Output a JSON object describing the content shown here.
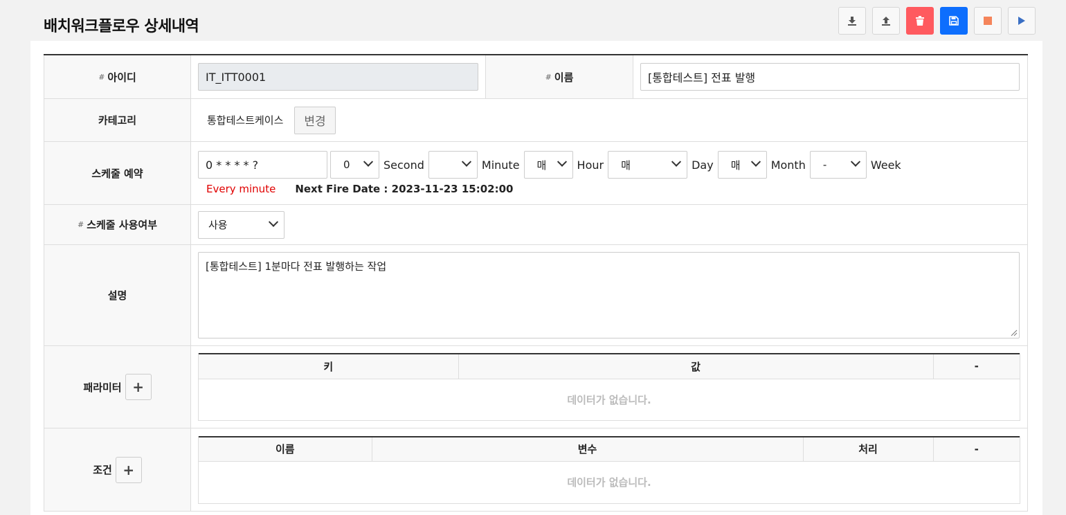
{
  "page": {
    "title": "배치워크플로우 상세내역"
  },
  "toolbar": {
    "buttons": [
      {
        "icon": "download-icon"
      },
      {
        "icon": "upload-icon"
      },
      {
        "icon": "trash-icon",
        "color": "#ff5a5f"
      },
      {
        "icon": "save-icon",
        "color": "#0d6efd"
      },
      {
        "icon": "stop-icon",
        "icon_color": "#f5855b"
      },
      {
        "icon": "play-icon",
        "icon_color": "#3a6fc4"
      }
    ]
  },
  "form": {
    "id": {
      "label": "아이디",
      "value": "IT_ITT0001"
    },
    "name": {
      "label": "이름",
      "value": "[통합테스트] 전표 발행"
    },
    "category": {
      "label": "카테고리",
      "value": "통합테스트케이스",
      "change_label": "변경"
    },
    "schedule": {
      "label": "스케줄 예약",
      "cron": "0 * * * * ?",
      "second": {
        "value": "0",
        "unit": "Second"
      },
      "minute": {
        "value": "",
        "unit": "Minute"
      },
      "hour": {
        "value": "매",
        "unit": "Hour"
      },
      "day": {
        "value": "매",
        "unit": "Day"
      },
      "month": {
        "value": "매",
        "unit": "Month"
      },
      "week": {
        "value": "-",
        "unit": "Week"
      },
      "description": "Every minute",
      "next_fire": "Next Fire Date : 2023-11-23 15:02:00"
    },
    "schedule_use": {
      "label": "스케줄 사용여부",
      "value": "사용"
    },
    "description": {
      "label": "설명",
      "value": "[통합테스트] 1분마다 전표 발행하는 작업"
    },
    "parameters": {
      "label": "패라미터",
      "columns": [
        "키",
        "값",
        "-"
      ],
      "empty": "데이터가 없습니다."
    },
    "conditions": {
      "label": "조건",
      "columns": [
        "이름",
        "변수",
        "처리",
        "-"
      ],
      "empty": "데이터가 없습니다."
    }
  },
  "colors": {
    "accent": "#0d6efd",
    "danger": "#ff5a5f",
    "highlight_text": "#e00000"
  }
}
